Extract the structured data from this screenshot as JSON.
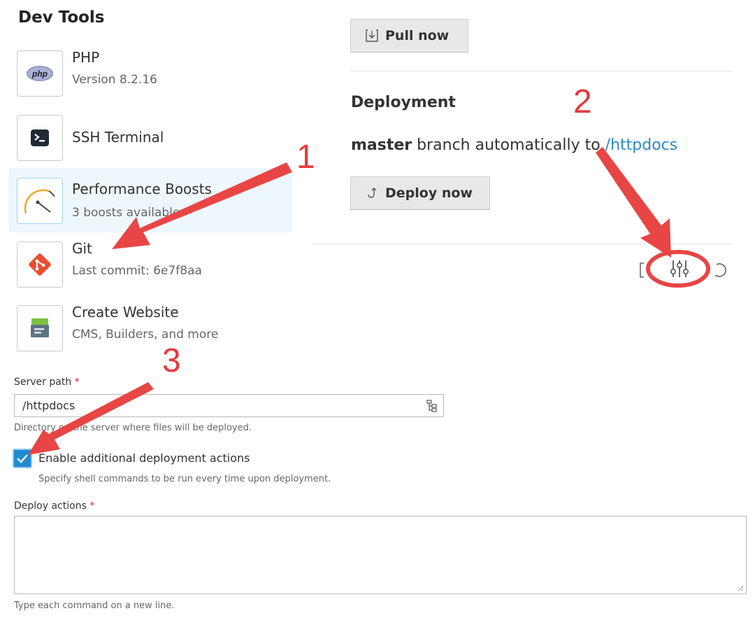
{
  "sidebar": {
    "title": "Dev Tools",
    "items": [
      {
        "name": "PHP",
        "sub": "Version 8.2.16",
        "icon": "php-icon"
      },
      {
        "name": "SSH Terminal",
        "sub": "",
        "icon": "terminal-icon"
      },
      {
        "name": "Performance Boosts",
        "sub": "3 boosts available",
        "icon": "speedometer-icon",
        "selected": true
      },
      {
        "name": "Git",
        "sub": "Last commit: 6e7f8aa",
        "icon": "git-icon"
      },
      {
        "name": "Create Website",
        "sub": "CMS, Builders, and more",
        "icon": "website-box-icon"
      }
    ]
  },
  "git_panel": {
    "pull_button": "Pull now",
    "deployment_heading": "Deployment",
    "branch": "master",
    "branch_text": " branch automatically to ",
    "target_path": "/httpdocs",
    "deploy_button": "Deploy now",
    "icons": [
      "bracket-icon",
      "settings-sliders-icon",
      "refresh-icon"
    ]
  },
  "form": {
    "server_path_label": "Server path",
    "required_mark": "*",
    "server_path_value": "/httpdocs",
    "server_path_hint": "Directory on the server where files will be deployed.",
    "enable_actions_label": "Enable additional deployment actions",
    "enable_actions_checked": true,
    "enable_actions_hint": "Specify shell commands to be run every time upon deployment.",
    "deploy_actions_label": "Deploy actions",
    "deploy_actions_value": "",
    "deploy_actions_hint": "Type each command on a new line."
  },
  "annotations": {
    "labels": [
      "1",
      "2",
      "3"
    ],
    "color": "#e33b3b"
  }
}
